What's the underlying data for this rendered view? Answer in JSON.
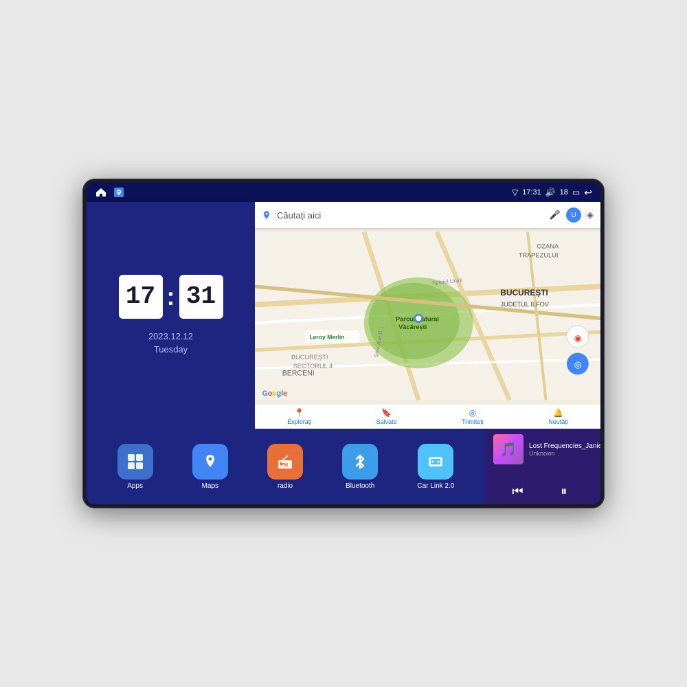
{
  "device": {
    "status_bar": {
      "left_icons": [
        "home",
        "maps"
      ],
      "time": "17:31",
      "signal_icon": "▽",
      "volume_icon": "🔊",
      "battery": "18",
      "battery_icon": "▭",
      "back_icon": "↩"
    },
    "clock": {
      "hour": "17",
      "minute": "31",
      "date": "2023.12.12",
      "day": "Tuesday"
    },
    "map": {
      "search_placeholder": "Căutați aici",
      "bottom_items": [
        {
          "label": "Explorați",
          "icon": "📍"
        },
        {
          "label": "Salvate",
          "icon": "🔖"
        },
        {
          "label": "Trimiteți",
          "icon": "◎"
        },
        {
          "label": "Noutăți",
          "icon": "🔔"
        }
      ]
    },
    "apps": [
      {
        "id": "apps",
        "label": "Apps",
        "icon": "⊞",
        "color_class": "icon-apps"
      },
      {
        "id": "maps",
        "label": "Maps",
        "icon": "📍",
        "color_class": "icon-maps"
      },
      {
        "id": "radio",
        "label": "radio",
        "icon": "📻",
        "color_class": "icon-radio"
      },
      {
        "id": "bluetooth",
        "label": "Bluetooth",
        "icon": "⟨)",
        "color_class": "icon-bluetooth"
      },
      {
        "id": "carlink",
        "label": "Car Link 2.0",
        "icon": "🔗",
        "color_class": "icon-carlink"
      }
    ],
    "music": {
      "title": "Lost Frequencies_Janieck Devy-...",
      "artist": "Unknown",
      "thumbnail_emoji": "🎵"
    }
  }
}
